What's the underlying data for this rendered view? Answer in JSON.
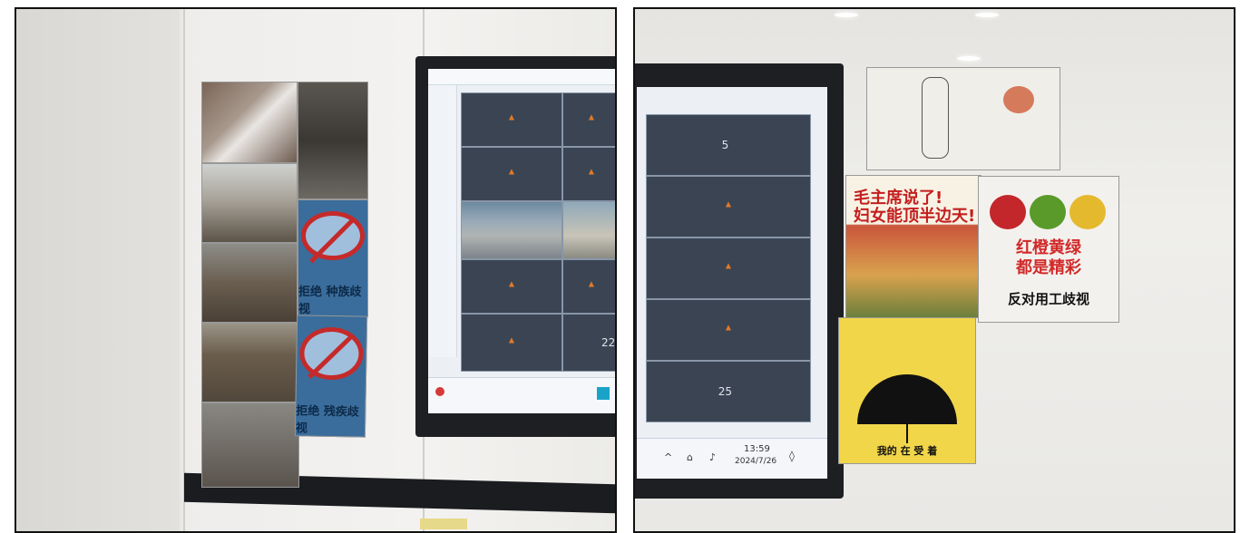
{
  "left": {
    "posters": {
      "top_caption": "拒绝 种族歧视",
      "bottom_caption": "拒绝 残疾歧视"
    },
    "screen_numbers": [
      "22"
    ]
  },
  "right": {
    "poster_chairman": {
      "line1": "毛主席说了!",
      "line2": "妇女能顶半边天!"
    },
    "poster_umbrella": {
      "text": "我的 在 受 着"
    },
    "poster_apples": {
      "line1": "红橙黄绿",
      "line2": "都是精彩",
      "slogan": "反对用工歧视"
    },
    "screen_numbers": [
      "5",
      "25"
    ],
    "taskbar": {
      "time": "13:59",
      "date": "2024/7/26"
    }
  }
}
